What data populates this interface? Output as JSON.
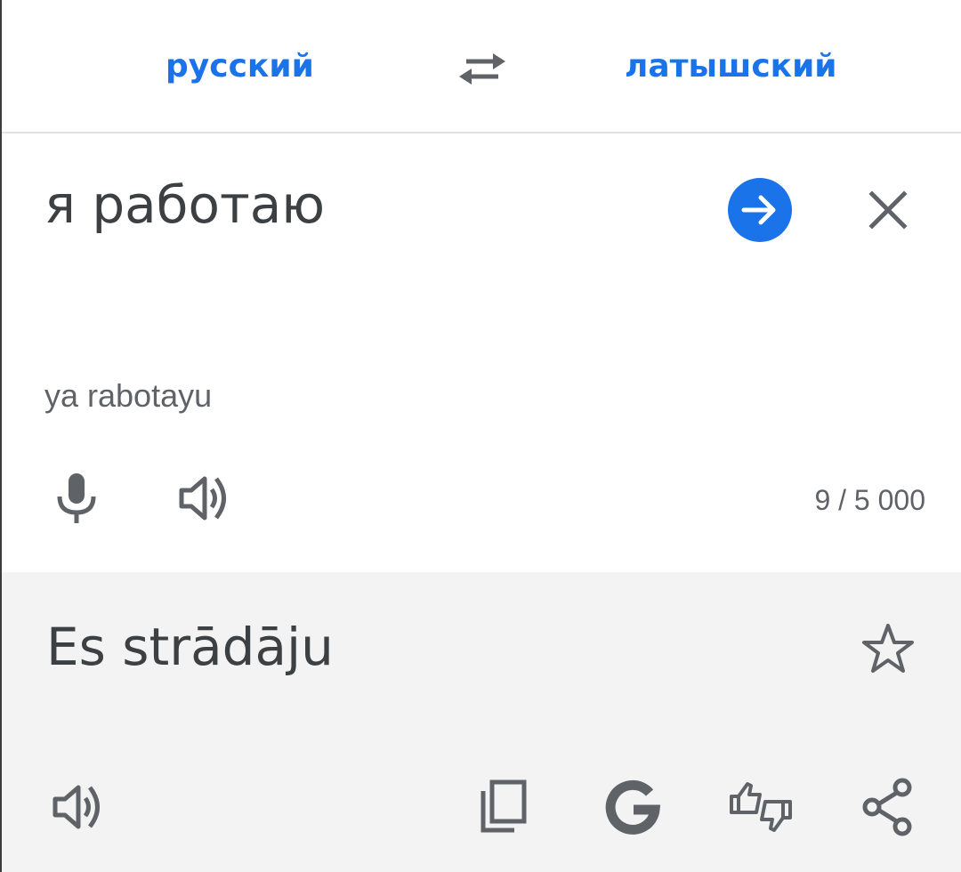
{
  "languages": {
    "source": "русский",
    "target": "латышский"
  },
  "input": {
    "text": "я работаю",
    "transliteration": "ya rabotayu",
    "char_count": "9 / 5 000"
  },
  "output": {
    "text": "Es strādāju"
  },
  "icons": {
    "swap": "swap-arrows-icon",
    "go": "arrow-right-circle-icon",
    "clear": "close-icon",
    "mic": "microphone-icon",
    "speaker": "speaker-icon",
    "star": "star-outline-icon",
    "copy": "copy-icon",
    "google": "google-g-icon",
    "rate": "thumbs-up-down-icon",
    "share": "share-icon"
  },
  "colors": {
    "accent": "#1a73e8",
    "icon": "#5f6368",
    "text": "#3c4043",
    "output_bg": "#f3f3f3"
  }
}
